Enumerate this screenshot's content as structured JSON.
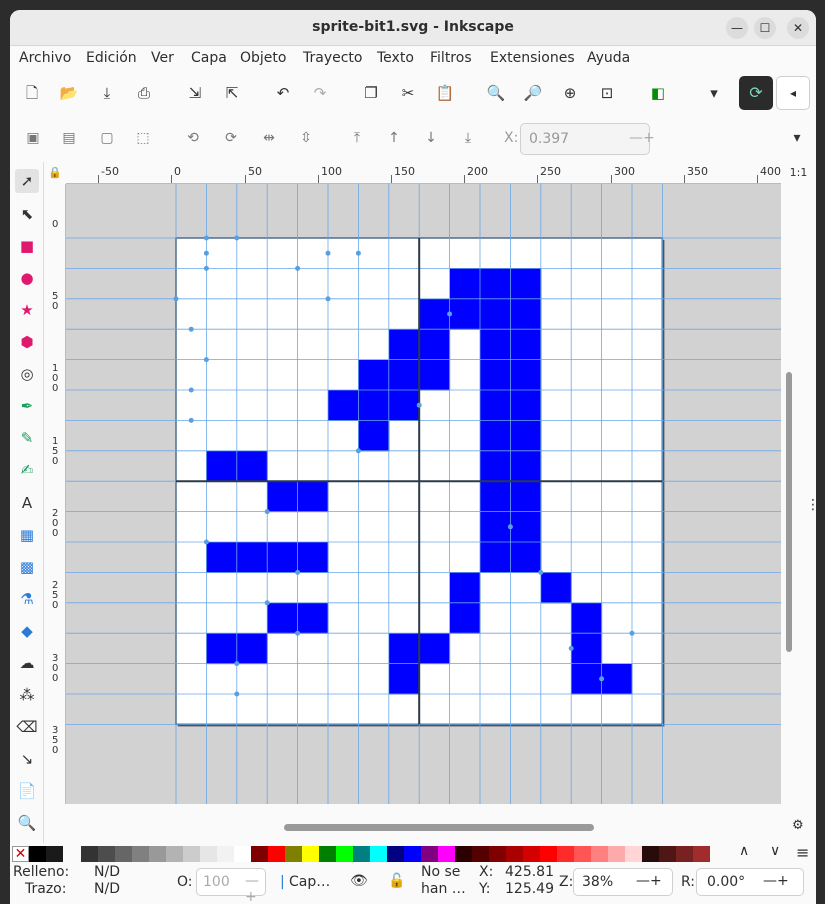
{
  "window": {
    "title": "sprite-bit1.svg - Inkscape",
    "minimize_glyph": "—",
    "maximize_glyph": "☐",
    "close_glyph": "✕"
  },
  "menu": [
    "Archivo",
    "Edición",
    "Ver",
    "Capa",
    "Objeto",
    "Trayecto",
    "Texto",
    "Filtros",
    "Extensiones",
    "Ayuda"
  ],
  "commands": [
    {
      "name": "new-document-icon",
      "glyph": "🗋"
    },
    {
      "name": "open-icon",
      "glyph": "📂"
    },
    {
      "name": "save-icon",
      "glyph": "⤓"
    },
    {
      "name": "print-icon",
      "glyph": "⎙"
    },
    {
      "name": "import-icon",
      "glyph": "⇲"
    },
    {
      "name": "export-icon",
      "glyph": "⇱"
    },
    {
      "name": "undo-icon",
      "glyph": "↶"
    },
    {
      "name": "redo-icon",
      "glyph": "↷"
    },
    {
      "name": "duplicate-icon",
      "glyph": "❐"
    },
    {
      "name": "cut-icon",
      "glyph": "✂"
    },
    {
      "name": "paste-icon",
      "glyph": "📋"
    },
    {
      "name": "zoom-selection-icon",
      "glyph": "🔍"
    },
    {
      "name": "zoom-drawing-icon",
      "glyph": "🔎"
    },
    {
      "name": "zoom-page-icon",
      "glyph": "⊕"
    },
    {
      "name": "zoom-center-icon",
      "glyph": "⊡"
    },
    {
      "name": "fill-stroke-icon",
      "glyph": "◧"
    },
    {
      "name": "more-options-icon",
      "glyph": "▾"
    }
  ],
  "snap": {
    "glyph": "⟳",
    "side_glyph": "◂"
  },
  "controls": {
    "x_label": "X:",
    "x_value": "0.397",
    "more_glyph": "▾"
  },
  "ruler": {
    "top_labels": [
      "-50",
      "0",
      "50",
      "100",
      "150",
      "200",
      "250",
      "300",
      "350",
      "400"
    ],
    "left_labels": [
      "0",
      "5\n0",
      "1\n0\n0",
      "1\n5\n0",
      "2\n0\n0",
      "2\n5\n0",
      "3\n0\n0",
      "3\n5\n0"
    ],
    "zoom_corner": "1:1",
    "lock_glyph": "🔒"
  },
  "tools": [
    {
      "name": "selector-tool-icon",
      "glyph": "➚",
      "active": true
    },
    {
      "name": "node-tool-icon",
      "glyph": "⬉"
    },
    {
      "name": "rectangle-tool-icon",
      "glyph": "■",
      "color": "#e0196f"
    },
    {
      "name": "ellipse-tool-icon",
      "glyph": "●",
      "color": "#e0196f"
    },
    {
      "name": "star-tool-icon",
      "glyph": "★",
      "color": "#e0196f"
    },
    {
      "name": "3d-box-tool-icon",
      "glyph": "⬢",
      "color": "#e0196f"
    },
    {
      "name": "spiral-tool-icon",
      "glyph": "◎"
    },
    {
      "name": "pen-tool-icon",
      "glyph": "✒",
      "color": "#1a9e5e"
    },
    {
      "name": "pencil-tool-icon",
      "glyph": "✎",
      "color": "#1a9e5e"
    },
    {
      "name": "calligraphy-tool-icon",
      "glyph": "✍",
      "color": "#1a9e5e"
    },
    {
      "name": "text-tool-icon",
      "glyph": "A"
    },
    {
      "name": "gradient-tool-icon",
      "glyph": "▦",
      "color": "#2a7bd6"
    },
    {
      "name": "mesh-tool-icon",
      "glyph": "▩",
      "color": "#2a7bd6"
    },
    {
      "name": "dropper-tool-icon",
      "glyph": "⚗",
      "color": "#2a7bd6"
    },
    {
      "name": "paint-bucket-tool-icon",
      "glyph": "◆",
      "color": "#2a7bd6"
    },
    {
      "name": "tweak-tool-icon",
      "glyph": "☁"
    },
    {
      "name": "spray-tool-icon",
      "glyph": "⁂"
    },
    {
      "name": "eraser-tool-icon",
      "glyph": "⌫"
    },
    {
      "name": "connector-tool-icon",
      "glyph": "↘"
    },
    {
      "name": "pages-tool-icon",
      "glyph": "📄"
    },
    {
      "name": "zoom-tool-icon",
      "glyph": "🔍"
    }
  ],
  "drawing": {
    "page_cols": 16,
    "page_rows": 16,
    "fill_color": "#0000ff",
    "filled_cells": [
      [
        9,
        1
      ],
      [
        10,
        1
      ],
      [
        11,
        1
      ],
      [
        8,
        2
      ],
      [
        9,
        2
      ],
      [
        10,
        2
      ],
      [
        11,
        2
      ],
      [
        7,
        3
      ],
      [
        8,
        3
      ],
      [
        10,
        3
      ],
      [
        11,
        3
      ],
      [
        6,
        4
      ],
      [
        7,
        4
      ],
      [
        8,
        4
      ],
      [
        10,
        4
      ],
      [
        11,
        4
      ],
      [
        5,
        5
      ],
      [
        6,
        5
      ],
      [
        7,
        5
      ],
      [
        10,
        5
      ],
      [
        11,
        5
      ],
      [
        6,
        6
      ],
      [
        10,
        6
      ],
      [
        11,
        6
      ],
      [
        1,
        7
      ],
      [
        2,
        7
      ],
      [
        10,
        7
      ],
      [
        11,
        7
      ],
      [
        3,
        8
      ],
      [
        4,
        8
      ],
      [
        10,
        8
      ],
      [
        11,
        8
      ],
      [
        10,
        9
      ],
      [
        11,
        9
      ],
      [
        1,
        10
      ],
      [
        2,
        10
      ],
      [
        3,
        10
      ],
      [
        4,
        10
      ],
      [
        10,
        10
      ],
      [
        11,
        10
      ],
      [
        9,
        11
      ],
      [
        12,
        11
      ],
      [
        3,
        12
      ],
      [
        4,
        12
      ],
      [
        9,
        12
      ],
      [
        13,
        12
      ],
      [
        1,
        13
      ],
      [
        2,
        13
      ],
      [
        7,
        13
      ],
      [
        8,
        13
      ],
      [
        13,
        13
      ],
      [
        7,
        14
      ],
      [
        13,
        14
      ],
      [
        14,
        14
      ]
    ]
  },
  "palette": {
    "none_glyph": "✕",
    "colors": [
      "#000000",
      "#1a1a1a",
      "#333333",
      "#4d4d4d",
      "#666666",
      "#808080",
      "#999999",
      "#b3b3b3",
      "#cccccc",
      "#e6e6e6",
      "#f2f2f2",
      "#ffffff",
      "#800000",
      "#ff0000",
      "#808000",
      "#ffff00",
      "#008000",
      "#00ff00",
      "#008080",
      "#00ffff",
      "#000080",
      "#0000ff",
      "#800080",
      "#ff00ff",
      "#2b0000",
      "#550000",
      "#800000",
      "#aa0000",
      "#d40000",
      "#ff0000",
      "#ff2a2a",
      "#ff5555",
      "#ff8080",
      "#ffaaaa",
      "#ffd5d5",
      "#280b0b",
      "#501616",
      "#782121",
      "#a02c2c"
    ],
    "scroll_up": "∧",
    "scroll_down": "∨",
    "menu_glyph": "≡"
  },
  "status": {
    "fill_label": "Relleno:",
    "fill_value": "N/D",
    "stroke_label": "Trazo:",
    "stroke_value": "N/D",
    "opacity_label": "O:",
    "opacity_value": "100",
    "layer_label": "Cap…",
    "eye_glyph": "👁",
    "lock_glyph": "🔓",
    "message": "No se\nhan …",
    "x_label": "X:",
    "x_value": "425.81",
    "y_label": "Y:",
    "y_value": "125.49",
    "zoom_label": "Z:",
    "zoom_value": "38%",
    "rotation_label": "R:",
    "rotation_value": "0.00°"
  }
}
